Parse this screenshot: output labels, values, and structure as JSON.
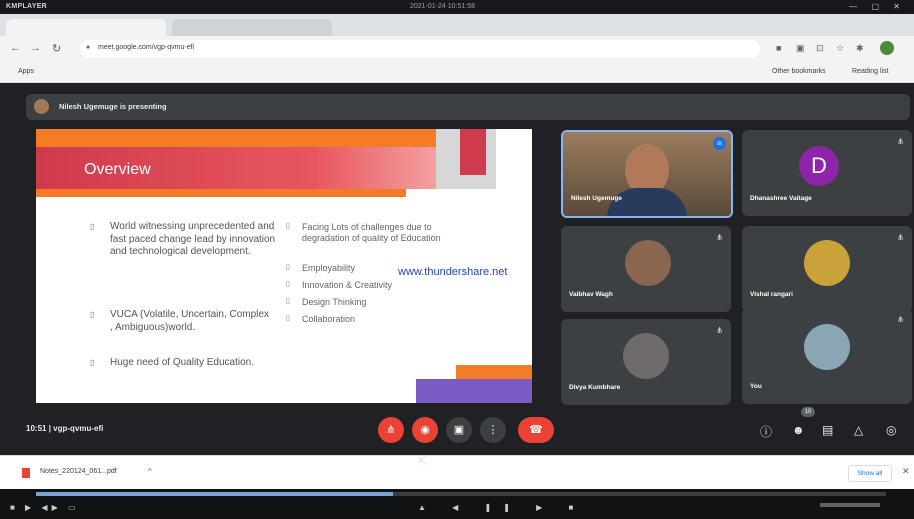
{
  "player": {
    "title": "KMPLAYER",
    "timestamp": "2021-01-24 10:51:58"
  },
  "browser": {
    "url": "meet.google.com/vgp-qvmu-efi",
    "bookmarks": {
      "apps": "Apps",
      "other": "Other bookmarks",
      "reading": "Reading list"
    }
  },
  "meet": {
    "presenting_text": "Nilesh Ugemuge is presenting",
    "slide": {
      "title": "Overview",
      "left_bullets": [
        "World witnessing unprecedented and fast paced change lead by innovation and technological development.",
        "VUCA (Volatile, Uncertain, Complex , Ambiguous)world.",
        "Huge need of Quality Education."
      ],
      "right_bullets": [
        "Facing Lots of challenges due to degradation of quality of Education",
        "Employability",
        "Innovation & Creativity",
        "Design Thinking",
        "Collaboration"
      ],
      "watermark": "www.thundershare.net"
    },
    "participants": [
      {
        "name": "Nilesh Ugemuge"
      },
      {
        "name": "Dhanashree Vaitage",
        "initial": "D",
        "color": "#8e24aa"
      },
      {
        "name": "Vaibhav Wagh"
      },
      {
        "name": "Vishal rangari"
      },
      {
        "name": "Divya Kumbhare"
      },
      {
        "name": "You"
      }
    ],
    "time": "10:51",
    "meeting_code": "vgp-qvmu-efi",
    "people_count": "10"
  },
  "downloads": {
    "file_name": "Notes_220124_061...pdf",
    "show_all": "Show all"
  },
  "player_progress": 0.42
}
